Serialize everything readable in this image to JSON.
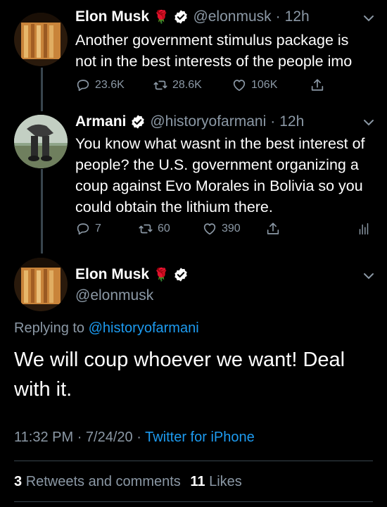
{
  "tweets": [
    {
      "name": "Elon Musk",
      "handle": "@elonmusk",
      "sep": "·",
      "time": "12h",
      "text": "Another government stimulus package is not in the best interests of the people imo",
      "replies": "23.6K",
      "retweets": "28.6K",
      "likes": "106K"
    },
    {
      "name": "Armani",
      "handle": "@historyofarmani",
      "sep": "·",
      "time": "12h",
      "text": "You know what wasnt in the best interest of people? the U.S. government organizing a coup against Evo Morales in Bolivia so you could obtain the lithium there.",
      "replies": "7",
      "retweets": "60",
      "likes": "390"
    }
  ],
  "main": {
    "name": "Elon Musk",
    "handle": "@elonmusk",
    "replying_prefix": "Replying to",
    "replying_to": "@historyofarmani",
    "text": "We will coup whoever we want! Deal with it.",
    "time": "11:32 PM",
    "date": "7/24/20",
    "sep1": "·",
    "sep2": "·",
    "source": "Twitter for iPhone",
    "retweets_count": "3",
    "retweets_label": "Retweets and comments",
    "likes_count": "11",
    "likes_label": "Likes"
  },
  "colors": {
    "background": "#000000",
    "text": "#ffffff",
    "secondary": "#8b98a5",
    "accent": "#1d9bf0",
    "rose": "#d9002b"
  }
}
